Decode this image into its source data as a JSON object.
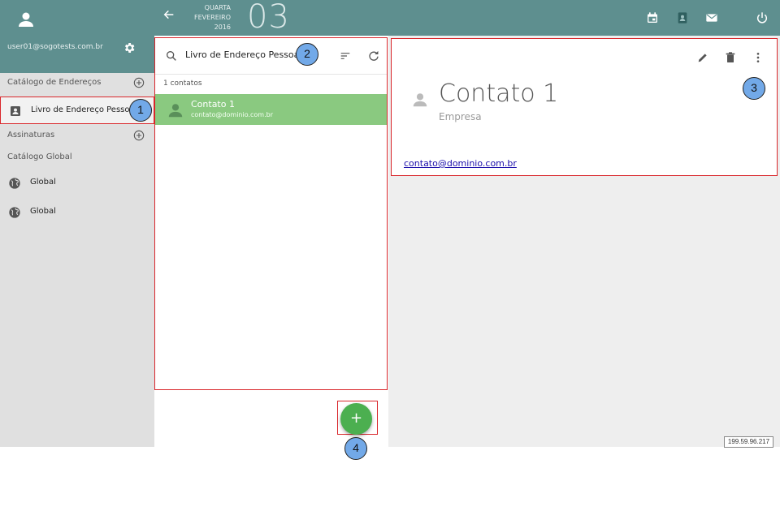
{
  "sidebar": {
    "user_email": "user01@sogotests.com.br",
    "sections": [
      {
        "label": "Catálogo de Endereços"
      },
      {
        "label": "Assinaturas"
      },
      {
        "label": "Catálogo Global"
      }
    ],
    "address_books": [
      {
        "label": "Livro de Endereço Pessoal",
        "icon": "contact-book-icon"
      }
    ],
    "global_items": [
      {
        "label": "Global",
        "icon": "globe-icon"
      },
      {
        "label": "Global",
        "icon": "globe-icon"
      }
    ]
  },
  "topbar": {
    "weekday": "QUARTA",
    "month": "FEVEREIRO",
    "year": "2016",
    "day": "03"
  },
  "list": {
    "title": "Livro de Endereço Pessoal",
    "count": "1 contatos",
    "contacts": [
      {
        "name": "Contato 1",
        "email": "contato@dominio.com.br"
      }
    ]
  },
  "detail": {
    "name": "Contato 1",
    "company": "Empresa",
    "email": "contato@dominio.com.br"
  },
  "fab": {
    "label": "+"
  },
  "callouts": [
    "1",
    "2",
    "3",
    "4"
  ],
  "ip": "199.59.96.217",
  "colors": {
    "header": "#5e8f8f",
    "selection": "#8ac980",
    "fab": "#4caf50",
    "highlight": "#d9262b",
    "callout": "#72a9e8"
  }
}
